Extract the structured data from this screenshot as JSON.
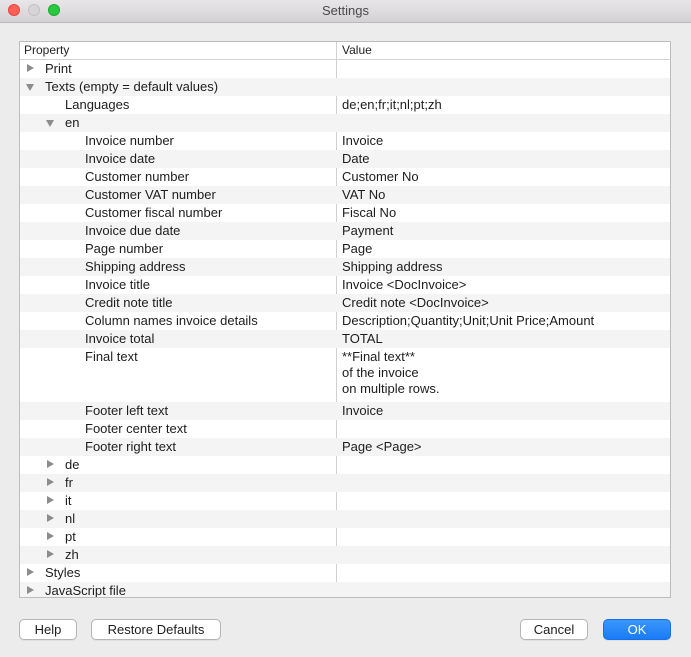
{
  "window": {
    "title": "Settings"
  },
  "table": {
    "headers": {
      "property": "Property",
      "value": "Value"
    },
    "rows": [
      {
        "level": 0,
        "toggle": "closed",
        "label": "Print",
        "value": ""
      },
      {
        "level": 0,
        "toggle": "open",
        "label": "Texts (empty = default values)",
        "value": ""
      },
      {
        "level": 1,
        "toggle": "none",
        "label": "Languages",
        "value": "de;en;fr;it;nl;pt;zh"
      },
      {
        "level": 1,
        "toggle": "open",
        "label": "en",
        "value": ""
      },
      {
        "level": 2,
        "toggle": "none",
        "label": "Invoice number",
        "value": "Invoice"
      },
      {
        "level": 2,
        "toggle": "none",
        "label": "Invoice date",
        "value": "Date"
      },
      {
        "level": 2,
        "toggle": "none",
        "label": "Customer number",
        "value": "Customer No"
      },
      {
        "level": 2,
        "toggle": "none",
        "label": "Customer VAT number",
        "value": "VAT No"
      },
      {
        "level": 2,
        "toggle": "none",
        "label": "Customer fiscal number",
        "value": "Fiscal No"
      },
      {
        "level": 2,
        "toggle": "none",
        "label": "Invoice due date",
        "value": "Payment"
      },
      {
        "level": 2,
        "toggle": "none",
        "label": "Page number",
        "value": "Page"
      },
      {
        "level": 2,
        "toggle": "none",
        "label": "Shipping address",
        "value": "Shipping address"
      },
      {
        "level": 2,
        "toggle": "none",
        "label": "Invoice title",
        "value": "Invoice <DocInvoice>"
      },
      {
        "level": 2,
        "toggle": "none",
        "label": "Credit note title",
        "value": "Credit note <DocInvoice>"
      },
      {
        "level": 2,
        "toggle": "none",
        "label": "Column names invoice details",
        "value": "Description;Quantity;Unit;Unit Price;Amount"
      },
      {
        "level": 2,
        "toggle": "none",
        "label": "Invoice total",
        "value": "TOTAL"
      },
      {
        "level": 2,
        "toggle": "none",
        "label": "Final text",
        "value": "**Final text**\nof the invoice\non multiple rows.",
        "lines": 3
      },
      {
        "level": 2,
        "toggle": "none",
        "label": "Footer left text",
        "value": "Invoice"
      },
      {
        "level": 2,
        "toggle": "none",
        "label": "Footer center text",
        "value": ""
      },
      {
        "level": 2,
        "toggle": "none",
        "label": "Footer right text",
        "value": "Page <Page>"
      },
      {
        "level": 1,
        "toggle": "closed",
        "label": "de",
        "value": ""
      },
      {
        "level": 1,
        "toggle": "closed",
        "label": "fr",
        "value": ""
      },
      {
        "level": 1,
        "toggle": "closed",
        "label": "it",
        "value": ""
      },
      {
        "level": 1,
        "toggle": "closed",
        "label": "nl",
        "value": ""
      },
      {
        "level": 1,
        "toggle": "closed",
        "label": "pt",
        "value": ""
      },
      {
        "level": 1,
        "toggle": "closed",
        "label": "zh",
        "value": ""
      },
      {
        "level": 0,
        "toggle": "closed",
        "label": "Styles",
        "value": ""
      },
      {
        "level": 0,
        "toggle": "closed",
        "label": "JavaScript file",
        "value": ""
      }
    ]
  },
  "buttons": {
    "help": "Help",
    "restore": "Restore Defaults",
    "cancel": "Cancel",
    "ok": "OK"
  },
  "colors": {
    "ok_button": "#1a7cf7",
    "close": "#fe5f57",
    "maximize": "#29c940"
  }
}
